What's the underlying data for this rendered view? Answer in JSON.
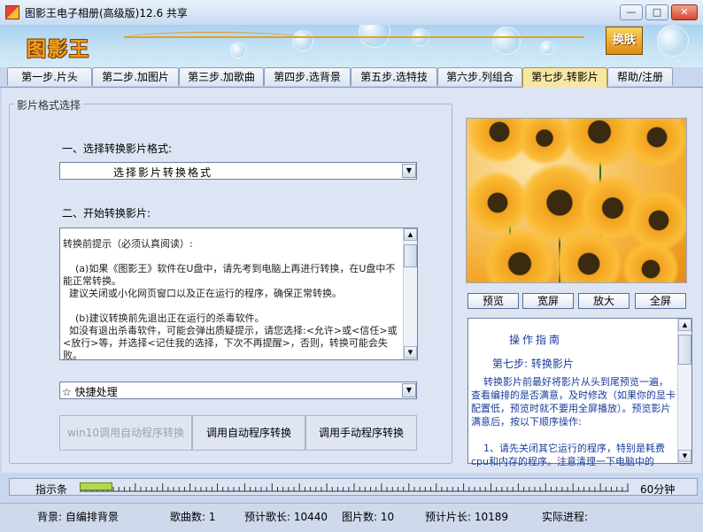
{
  "window": {
    "title": "图影王电子相册(高级版)12.6 共享",
    "controls": [
      "—",
      "□",
      "✕"
    ]
  },
  "banner": {
    "logo": "图影王",
    "badge": "换肤"
  },
  "tabs": [
    {
      "label": "第一步.片头",
      "active": false
    },
    {
      "label": "第二步.加图片",
      "active": false
    },
    {
      "label": "第三步.加歌曲",
      "active": false
    },
    {
      "label": "第四步.选背景",
      "active": false
    },
    {
      "label": "第五步.选特技",
      "active": false
    },
    {
      "label": "第六步.列组合",
      "active": false
    },
    {
      "label": "第七步.转影片",
      "active": true
    },
    {
      "label": "帮助/注册",
      "active": false
    }
  ],
  "format_panel": {
    "group_title": "影片格式选择",
    "select_label": "一、选择转换影片格式:",
    "select_value": "选择影片转换格式",
    "start_label": "二、开始转换影片:",
    "notice": "转换前提示（必须认真阅读）:\n\n    (a)如果《图影王》软件在U盘中，请先考到电脑上再进行转换，在U盘中不能正常转换。\n  建议关闭或小化网页窗口以及正在运行的程序，确保正常转换。\n\n    (b)建议转换前先退出正在运行的杀毒软件。\n  如没有退出杀毒软件，可能会弹出质疑提示，请您选择:<允许>或<信任>或<放行>等，并选择<记住我的选择，下次不再提醒>，否则，转换可能会失败。",
    "quick_value": "☆ 快捷处理",
    "buttons": {
      "win10_auto": "win10调用自动程序转换",
      "auto": "调用自动程序转换",
      "manual": "调用手动程序转换"
    }
  },
  "preview": {
    "buttons": {
      "preview": "预览",
      "wide": "宽屏",
      "zoom": "放大",
      "full": "全屏"
    }
  },
  "guide": {
    "title": "操作指南",
    "step": "第七步: 转换影片",
    "body": "    转换影片前最好将影片从头到尾预览一遍，查看编排的是否满意，及时修改（如果你的显卡配置低，预览时就不要用全屏播放）。预览影片满意后，按以下顺序操作:\n\n    1、请先关闭其它运行的程序，特别是耗费cpu和内存的程序。注意清理一下电脑中的"
  },
  "progress": {
    "label": "指示条",
    "fraction": 0.06,
    "time": "60分钟"
  },
  "status": {
    "background": "背景: 自编排背景",
    "songs": "歌曲数:  1",
    "song_length": "预计歌长: 10440",
    "images": "图片数:  10",
    "film_length": "预计片长:    10189",
    "actual": "实际进程:"
  }
}
